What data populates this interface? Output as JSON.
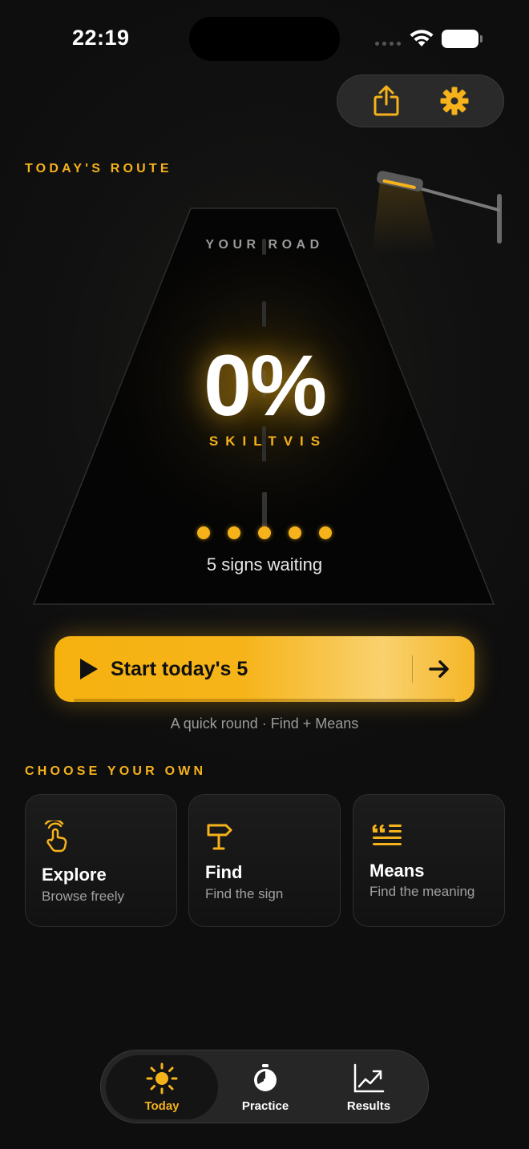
{
  "status": {
    "time": "22:19"
  },
  "toolbar": {
    "share_icon": "share-icon",
    "settings_icon": "gear-icon"
  },
  "route": {
    "section_label": "TODAY'S ROUTE",
    "road_label": "YOUR ROAD",
    "progress_percent": "0%",
    "brand": "SKILTVIS",
    "waiting_text": "5 signs waiting",
    "waiting_count": 5
  },
  "start": {
    "label": "Start today's 5",
    "subtitle": "A quick round · Find + Means"
  },
  "choose": {
    "section_label": "CHOOSE YOUR OWN",
    "cards": [
      {
        "title": "Explore",
        "subtitle": "Browse freely",
        "icon": "tap-hand-icon"
      },
      {
        "title": "Find",
        "subtitle": "Find the sign",
        "icon": "signpost-icon"
      },
      {
        "title": "Means",
        "subtitle": "Find the meaning",
        "icon": "quote-lines-icon"
      }
    ]
  },
  "tabs": [
    {
      "label": "Today",
      "icon": "sun-icon",
      "active": true
    },
    {
      "label": "Practice",
      "icon": "timer-icon",
      "active": false
    },
    {
      "label": "Results",
      "icon": "chart-icon",
      "active": false
    }
  ],
  "colors": {
    "accent": "#f5b21b",
    "background": "#0f0f0f"
  }
}
